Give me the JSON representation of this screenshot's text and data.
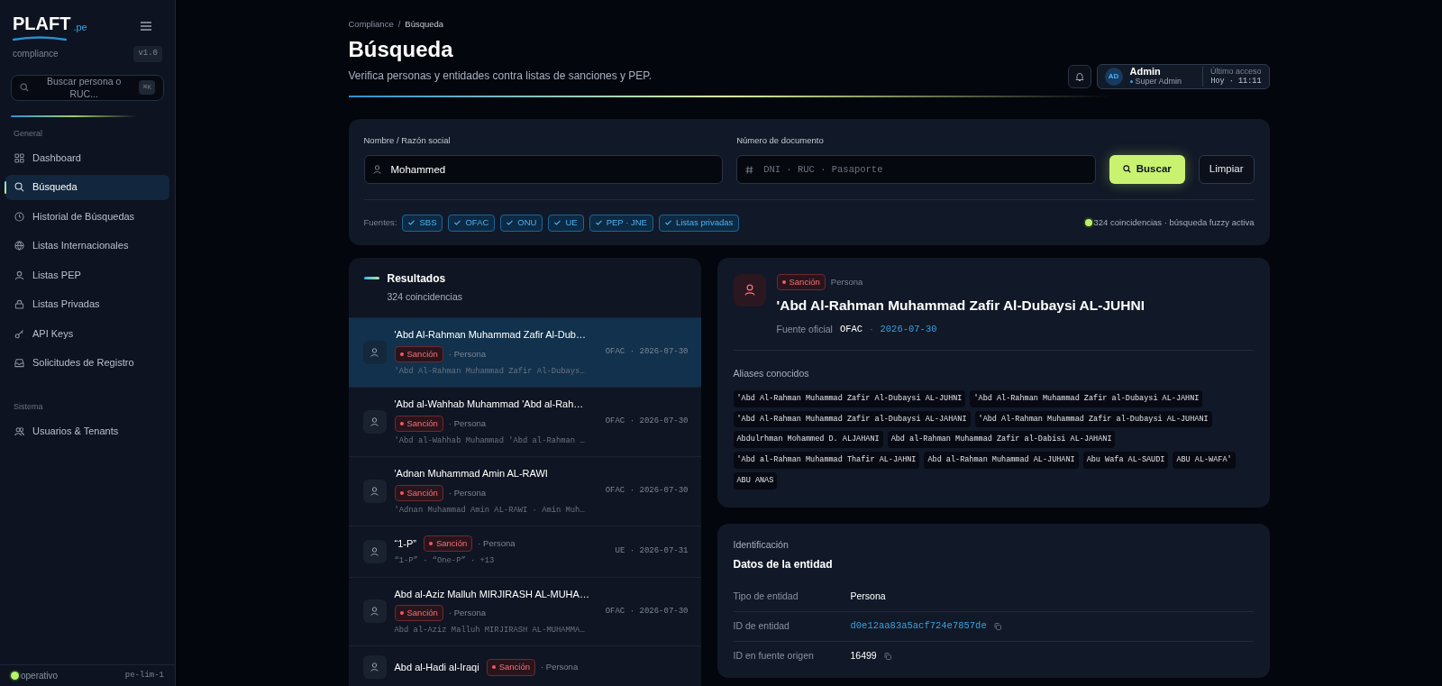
{
  "sidebar": {
    "logo": "PLAFT",
    "logo_suffix": ".pe",
    "subtitle": "compliance",
    "version": "v1.0",
    "search": {
      "placeholder": "Buscar persona o RUC...",
      "shortcut": "⌘K"
    },
    "sections": [
      {
        "title": "General",
        "items": [
          {
            "label": "Dashboard",
            "selected": false
          },
          {
            "label": "Búsqueda",
            "selected": true
          },
          {
            "label": "Historial de Búsquedas",
            "selected": false
          },
          {
            "label": "Listas Internacionales",
            "selected": false
          },
          {
            "label": "Listas PEP",
            "selected": false
          },
          {
            "label": "Listas Privadas",
            "selected": false
          },
          {
            "label": "API Keys",
            "selected": false
          },
          {
            "label": "Solicitudes de Registro",
            "selected": false
          }
        ]
      },
      {
        "title": "Sistema",
        "items": [
          {
            "label": "Usuarios & Tenants",
            "selected": false
          }
        ]
      }
    ],
    "status": "operativo",
    "region": "pe-lim-1"
  },
  "header": {
    "breadcrumb": [
      "Compliance",
      "Búsqueda"
    ],
    "breadcrumb_separator": "/",
    "title": "Búsqueda",
    "subtitle": "Verifica personas y entidades contra listas de sanciones y PEP.",
    "user": {
      "initials": "AD",
      "name": "Admin",
      "role": "Super Admin",
      "last_access_label": "Último acceso",
      "last_access": "Hoy · 11:11"
    }
  },
  "search_form": {
    "name_label": "Nombre / Razón social",
    "name_value": "Mohammed",
    "doc_label": "Número de documento",
    "doc_placeholder": "DNI · RUC · Pasaporte",
    "search_button": "Buscar",
    "clear_button": "Limpiar",
    "sources_label": "Fuentes:",
    "sources": [
      {
        "label": "SBS",
        "checked": true
      },
      {
        "label": "OFAC",
        "checked": true
      },
      {
        "label": "ONU",
        "checked": true
      },
      {
        "label": "UE",
        "checked": true
      },
      {
        "label": "PEP · JNE",
        "checked": true
      },
      {
        "label": "Listas privadas",
        "checked": true
      }
    ],
    "summary": "324 coincidencias · búsqueda fuzzy activa"
  },
  "results": {
    "title": "Resultados",
    "count": "324 coincidencias",
    "rows": [
      {
        "name": "'Abd Al-Rahman Muhammad Zafir Al-Dub…",
        "tag": "Sanción",
        "type": "· Persona",
        "source": "OFAC · 2026-07-30",
        "aliases": "'Abd Al-Rahman Muhammad Zafir Al-Dubays…",
        "selected": true
      },
      {
        "name": "'Abd al-Wahhab Muhammad 'Abd al-Rah…",
        "tag": "Sanción",
        "type": "· Persona",
        "source": "OFAC · 2026-07-30",
        "aliases": "'Abd al-Wahhab Muhammad 'Abd al-Rahman …",
        "selected": false
      },
      {
        "name": "'Adnan Muhammad Amin AL-RAWI",
        "tag": "Sanción",
        "type": "· Persona",
        "source": "OFAC · 2026-07-30",
        "aliases": "'Adnan Muhammad Amin AL-RAWI · Amin Muh…",
        "selected": false
      },
      {
        "name": "“1-P”",
        "tag": "Sanción",
        "type": "· Persona",
        "source": "UE · 2026-07-31",
        "aliases": "“1-P” · “One-P” · +13",
        "selected": false
      },
      {
        "name": "Abd al-Aziz Malluh MIRJIRASH AL-MUHA…",
        "tag": "Sanción",
        "type": "· Persona",
        "source": "OFAC · 2026-07-30",
        "aliases": "Abd al-Aziz Malluh MIRJIRASH AL-MUHAMMA…",
        "selected": false
      },
      {
        "name": "Abd al-Hadi al-Iraqi",
        "tag": "Sanción",
        "type": "· Persona",
        "selected": false
      }
    ]
  },
  "detail": {
    "tag": "Sanción",
    "type": "Persona",
    "name": "'Abd Al-Rahman Muhammad Zafir Al-Dubaysi AL-JUHNI",
    "source_label": "Fuente oficial",
    "source": "OFAC",
    "separator": "·",
    "date": "2026-07-30",
    "aliases_title": "Aliases conocidos",
    "aliases": [
      "'Abd Al-Rahman Muhammad Zafir Al-Dubaysi AL-JUHNI",
      "'Abd Al-Rahman Muhammad Zafir al-Dubaysi AL-JAHNI",
      "'Abd Al-Rahman Muhammad Zafir al-Dubaysi AL-JAHANI",
      "'Abd Al-Rahman Muhammad Zafir al-Dubaysi AL-JUHANI",
      "Abdulrhman Mohammed D. ALJAHANI",
      "Abd al-Rahman Muhammad Zafir al-Dabisi AL-JAHANI",
      "'Abd al-Rahman Muhammad Thafir AL-JAHNI",
      "Abd al-Rahman Muhammad AL-JUHANI",
      "Abu Wafa AL-SAUDI",
      "ABU AL-WAFA'",
      "ABU ANAS"
    ]
  },
  "identification": {
    "eyebrow": "Identificación",
    "title": "Datos de la entidad",
    "rows": [
      {
        "label": "Tipo de entidad",
        "value": "Persona",
        "kind": "text",
        "copyable": false
      },
      {
        "label": "ID de entidad",
        "value": "d0e12aa83a5acf724e7857de",
        "kind": "link",
        "copyable": true
      },
      {
        "label": "ID en fuente origen",
        "value": "16499",
        "kind": "text",
        "copyable": true
      }
    ]
  }
}
